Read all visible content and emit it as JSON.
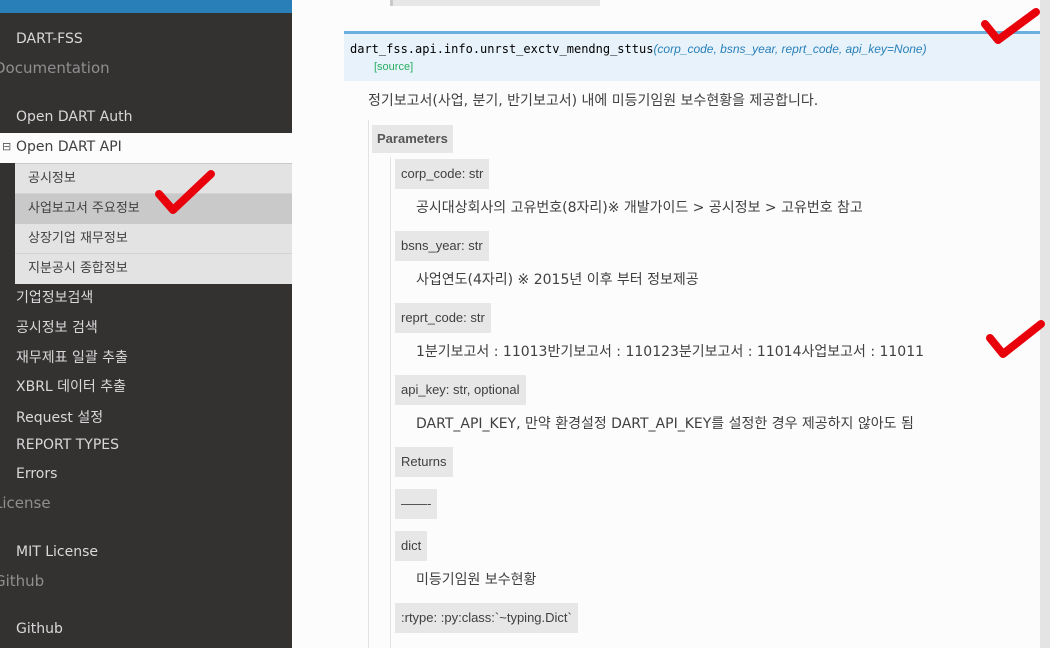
{
  "sidebar": {
    "project_title": "DART-FSS",
    "captions": [
      "Documentation",
      "License",
      "Github"
    ],
    "items": [
      {
        "label": "Open DART Auth"
      },
      {
        "label": "Open DART API"
      },
      {
        "label": "기업정보검색"
      },
      {
        "label": "공시정보 검색"
      },
      {
        "label": "재무제표 일괄 추출"
      },
      {
        "label": "XBRL 데이터 추출"
      },
      {
        "label": "Request 설정"
      },
      {
        "label": "REPORT TYPES"
      },
      {
        "label": "Errors"
      },
      {
        "label": "MIT License"
      },
      {
        "label": "Github"
      }
    ],
    "expander": "⊟",
    "subitems": [
      {
        "label": "공시정보"
      },
      {
        "label": "사업보고서 주요정보"
      },
      {
        "label": "상장기업 재무정보"
      },
      {
        "label": "지분공시 종합정보"
      }
    ]
  },
  "signature": {
    "name": "dart_fss.api.info.unrst_exctv_mendng_sttus",
    "params": "(corp_code, bsns_year, reprt_code, api_key=None)",
    "source": "[source]"
  },
  "description": "정기보고서(사업, 분기, 반기보고서) 내에 미등기임원 보수현황을 제공합니다.",
  "field_label": "Parameters",
  "params": [
    {
      "name": "corp_code: str",
      "desc": "공시대상회사의 고유번호(8자리)※ 개발가이드 > 공시정보 > 고유번호 참고"
    },
    {
      "name": "bsns_year: str",
      "desc": "사업연도(4자리) ※ 2015년 이후 부터 정보제공"
    },
    {
      "name": "reprt_code: str",
      "desc": "1분기보고서 : 11013반기보고서 : 110123분기보고서 : 11014사업보고서 : 11011"
    },
    {
      "name": "api_key: str, optional",
      "desc": "DART_API_KEY, 만약 환경설정 DART_API_KEY를 설정한 경우 제공하지 않아도 됨"
    },
    {
      "name": "Returns",
      "desc": ""
    },
    {
      "name": "——-",
      "desc": ""
    },
    {
      "name": "dict",
      "desc": "미등기임원 보수현황"
    },
    {
      "name": ":rtype: :py:class:`~typing.Dict`",
      "desc": ""
    }
  ],
  "colors": {
    "sidebar_bg": "#343131",
    "accent": "#2980b9",
    "check_red": "#e8000b",
    "source_green": "#27ae60"
  }
}
